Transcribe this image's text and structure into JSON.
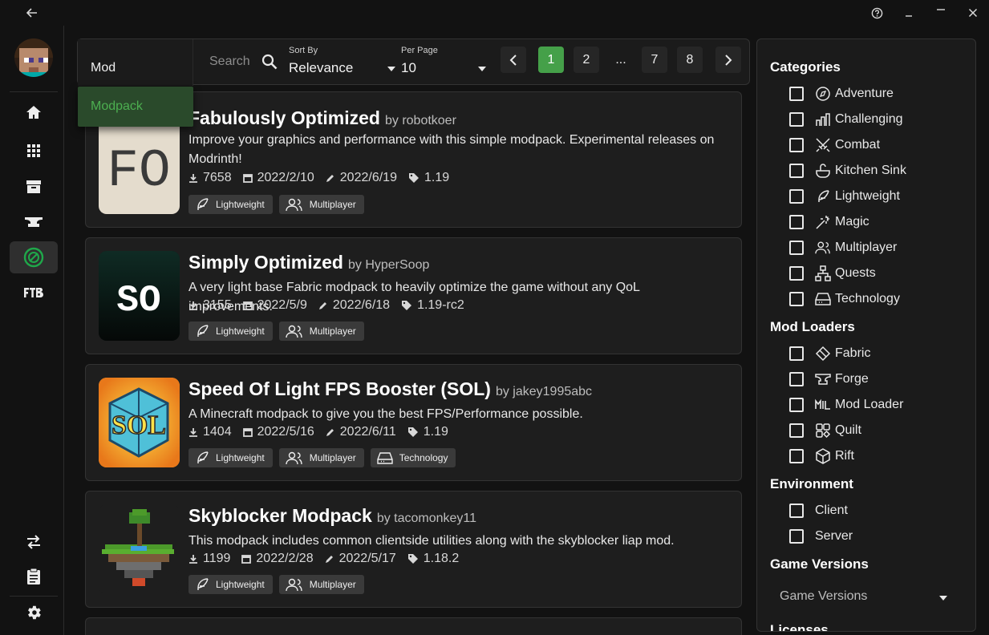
{
  "titlebar": {
    "back_icon": "arrow-left-icon",
    "help_icon": "help-circle-icon",
    "minimize_icon": "minimize-icon",
    "maximize_icon": "maximize-icon",
    "close_icon": "close-icon"
  },
  "sidebar": {
    "items": [
      {
        "name": "home",
        "icon": "home-icon"
      },
      {
        "name": "instances",
        "icon": "grid-icon"
      },
      {
        "name": "archive",
        "icon": "archive-icon"
      },
      {
        "name": "forge",
        "icon": "anvil-icon"
      },
      {
        "name": "modrinth",
        "icon": "modrinth-icon",
        "active": true
      },
      {
        "name": "ftb",
        "icon": "ftb-icon",
        "label": "FTB"
      }
    ],
    "bottom": [
      {
        "name": "swap",
        "icon": "swap-icon"
      },
      {
        "name": "clipboard",
        "icon": "clipboard-icon"
      },
      {
        "name": "settings",
        "icon": "gear-icon"
      }
    ]
  },
  "controls": {
    "source_value": "Mod",
    "search_placeholder": "Search",
    "sort_label": "Sort By",
    "sort_value": "Relevance",
    "perpage_label": "Per Page",
    "perpage_value": "10",
    "pages": [
      "1",
      "2",
      "...",
      "7",
      "8"
    ],
    "current_page": "1"
  },
  "dropdown": {
    "option": "Modpack"
  },
  "results": [
    {
      "title": "Fabulously Optimized",
      "author": "by robotkoer",
      "description": "Improve your graphics and performance with this simple modpack. Experimental releases on Modrinth!",
      "downloads": "7658",
      "created": "2022/2/10",
      "updated": "2022/6/19",
      "version": "1.19",
      "tags": [
        "Lightweight",
        "Multiplayer"
      ],
      "thumb_text": "FO"
    },
    {
      "title": "Simply Optimized",
      "author": "by HyperSoop",
      "description": "A very light base Fabric modpack to heavily optimize the game without any QoL improvements.",
      "downloads": "3155",
      "created": "2022/5/9",
      "updated": "2022/6/18",
      "version": "1.19-rc2",
      "tags": [
        "Lightweight",
        "Multiplayer"
      ],
      "thumb_text": "SO"
    },
    {
      "title": "Speed Of Light FPS Booster (SOL)",
      "author": "by jakey1995abc",
      "description": "A Minecraft modpack to give you the best FPS/Performance possible.",
      "downloads": "1404",
      "created": "2022/5/16",
      "updated": "2022/6/11",
      "version": "1.19",
      "tags": [
        "Lightweight",
        "Multiplayer",
        "Technology"
      ],
      "thumb_text": "SOL"
    },
    {
      "title": "Skyblocker Modpack",
      "author": "by tacomonkey11",
      "description": "This modpack includes common clientside utilities along with the skyblocker liap mod.",
      "downloads": "1199",
      "created": "2022/2/28",
      "updated": "2022/5/17",
      "version": "1.18.2",
      "tags": [
        "Lightweight",
        "Multiplayer"
      ]
    }
  ],
  "filters": {
    "categories_title": "Categories",
    "categories": [
      "Adventure",
      "Challenging",
      "Combat",
      "Kitchen Sink",
      "Lightweight",
      "Magic",
      "Multiplayer",
      "Quests",
      "Technology"
    ],
    "loaders_title": "Mod Loaders",
    "loaders": [
      "Fabric",
      "Forge",
      "Mod Loader",
      "Quilt",
      "Rift"
    ],
    "environment_title": "Environment",
    "environment": [
      "Client",
      "Server"
    ],
    "versions_title": "Game Versions",
    "versions_placeholder": "Game Versions",
    "licenses_title": "Licenses"
  },
  "colors": {
    "accent": "#45a049",
    "background": "#121212",
    "card": "#1e1e1e",
    "tag": "#3a3a3a"
  }
}
